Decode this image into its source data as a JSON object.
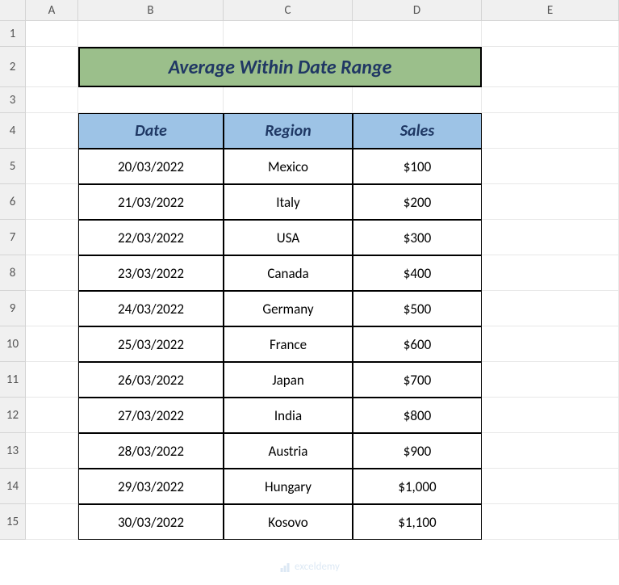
{
  "columns": [
    "A",
    "B",
    "C",
    "D",
    "E"
  ],
  "rows": [
    "1",
    "2",
    "3",
    "4",
    "5",
    "6",
    "7",
    "8",
    "9",
    "10",
    "11",
    "12",
    "13",
    "14",
    "15"
  ],
  "title": "Average Within Date Range",
  "table": {
    "headers": [
      "Date",
      "Region",
      "Sales"
    ],
    "data": [
      {
        "date": "20/03/2022",
        "region": "Mexico",
        "sales": "$100"
      },
      {
        "date": "21/03/2022",
        "region": "Italy",
        "sales": "$200"
      },
      {
        "date": "22/03/2022",
        "region": "USA",
        "sales": "$300"
      },
      {
        "date": "23/03/2022",
        "region": "Canada",
        "sales": "$400"
      },
      {
        "date": "24/03/2022",
        "region": "Germany",
        "sales": "$500"
      },
      {
        "date": "25/03/2022",
        "region": "France",
        "sales": "$600"
      },
      {
        "date": "26/03/2022",
        "region": "Japan",
        "sales": "$700"
      },
      {
        "date": "27/03/2022",
        "region": "India",
        "sales": "$800"
      },
      {
        "date": "28/03/2022",
        "region": "Austria",
        "sales": "$900"
      },
      {
        "date": "29/03/2022",
        "region": "Hungary",
        "sales": "$1,000"
      },
      {
        "date": "30/03/2022",
        "region": "Kosovo",
        "sales": "$1,100"
      }
    ]
  },
  "watermark": "exceldemy"
}
